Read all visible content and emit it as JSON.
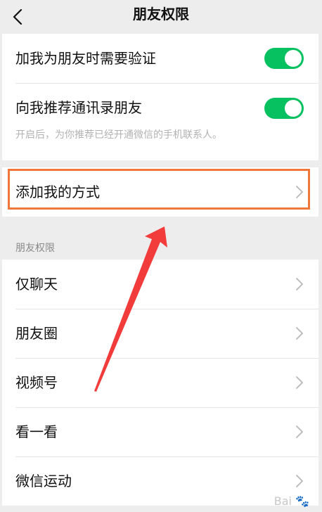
{
  "navbar": {
    "title": "朋友权限",
    "back_icon": "chevron-left-icon"
  },
  "verification": {
    "require_verify_label": "加我为朋友时需要验证",
    "require_verify_on": true,
    "recommend_contacts_label": "向我推荐通讯录朋友",
    "recommend_contacts_on": true,
    "recommend_hint": "开启后，为你推荐已经开通微信的手机联系人。"
  },
  "add_methods": {
    "label": "添加我的方式"
  },
  "friend_permissions": {
    "header": "朋友权限",
    "items": [
      {
        "label": "仅聊天"
      },
      {
        "label": "朋友圈"
      },
      {
        "label": "视频号"
      },
      {
        "label": "看一看"
      },
      {
        "label": "微信运动"
      }
    ]
  },
  "annotation": {
    "highlight_color": "#f0763a",
    "arrow_color": "#f23b3b"
  },
  "colors": {
    "toggle_on": "#07c160",
    "background": "#ededed"
  }
}
